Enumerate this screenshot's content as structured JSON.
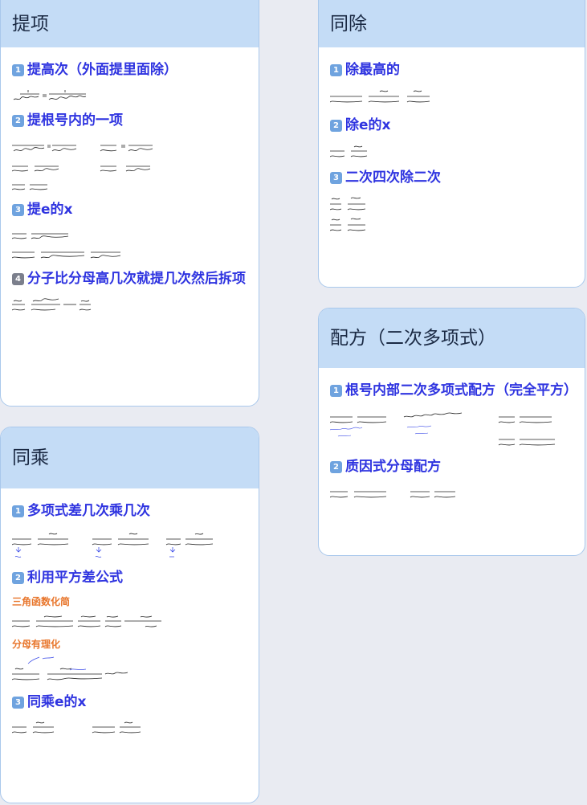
{
  "colors": {
    "header_bg": "#c4dcf6",
    "section_blue": "#2f34e0",
    "sub_orange": "#e8762c",
    "badge": "#6fa3df"
  },
  "card_tixiang": {
    "title": "提项",
    "sections": [
      {
        "num": "1",
        "title": "提高次（外面提里面除）"
      },
      {
        "num": "2",
        "title": "提根号内的一项"
      },
      {
        "num": "3",
        "title": "提e的x"
      },
      {
        "num": "4",
        "title": "分子比分母高几次就提几次然后拆项"
      }
    ]
  },
  "card_tongcheng": {
    "title": "同乘",
    "sections": [
      {
        "num": "1",
        "title": "多项式差几次乘几次"
      },
      {
        "num": "2",
        "title": "利用平方差公式"
      },
      {
        "num": "3",
        "title": "同乘e的x"
      }
    ],
    "subs": {
      "trig": "三角函数化简",
      "rational": "分母有理化"
    }
  },
  "card_tongchu": {
    "title": "同除",
    "sections": [
      {
        "num": "1",
        "title": "除最高的"
      },
      {
        "num": "2",
        "title": "除e的x"
      },
      {
        "num": "3",
        "title": "二次四次除二次"
      }
    ]
  },
  "card_peifang": {
    "title": "配方（二次多项式）",
    "sections": [
      {
        "num": "1",
        "title": "根号内部二次多项式配方（完全平方）"
      },
      {
        "num": "2",
        "title": "质因式分母配方"
      }
    ]
  }
}
